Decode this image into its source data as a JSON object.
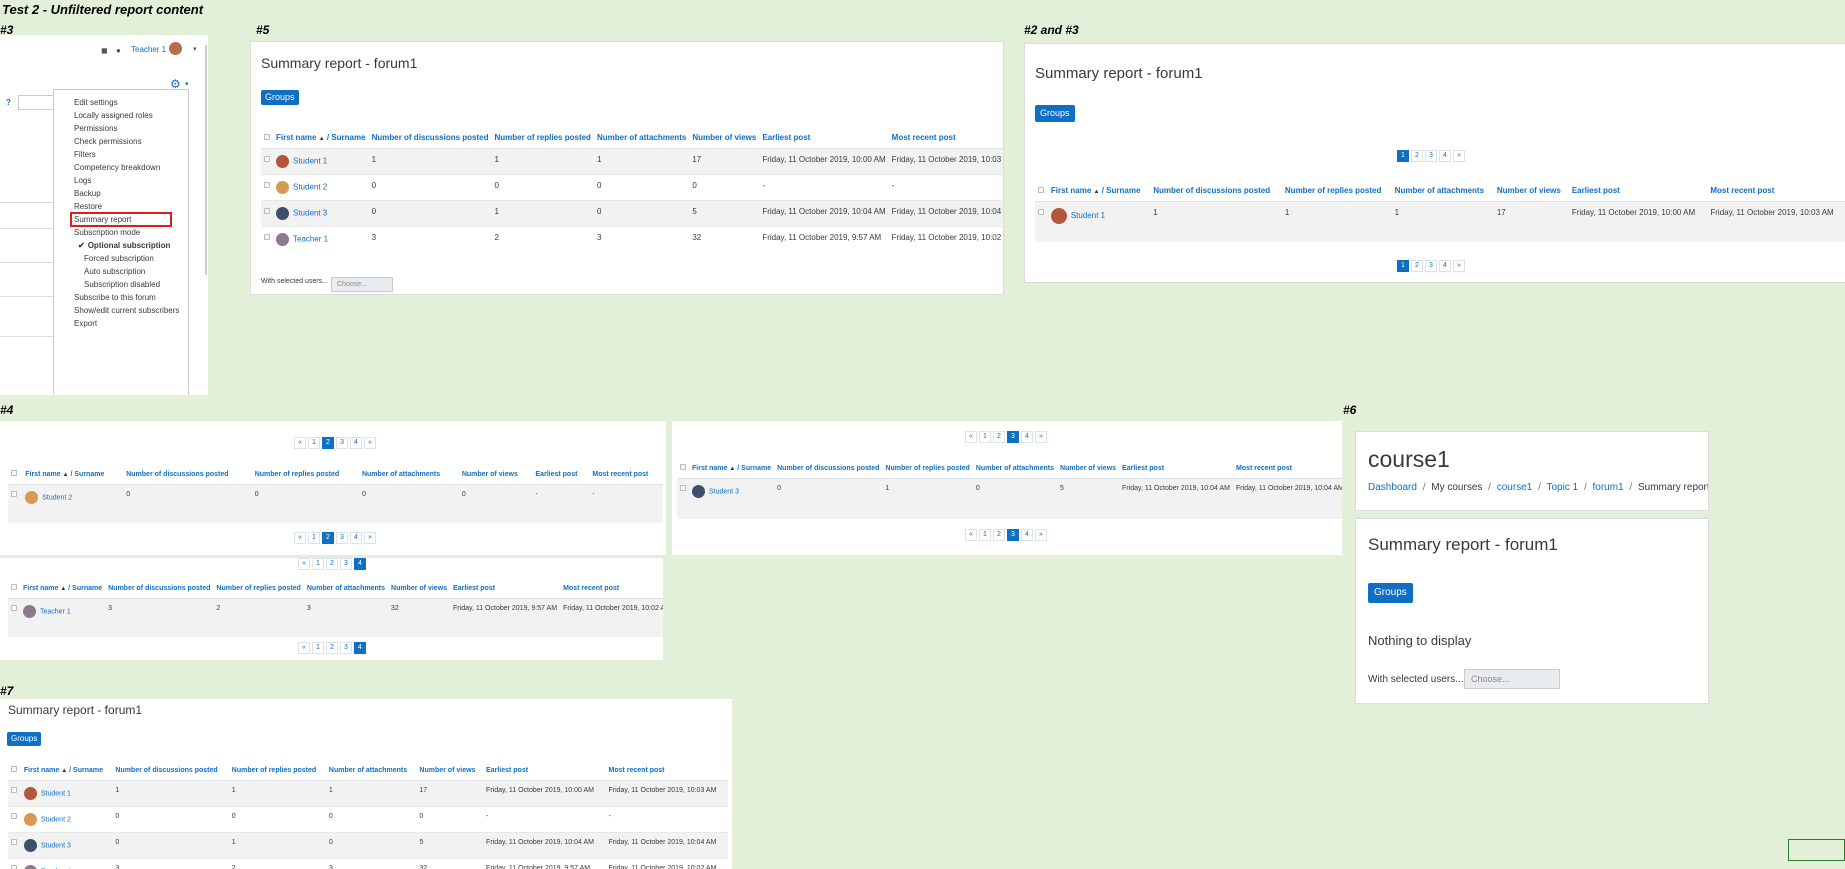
{
  "page_title": "Test 2 - Unfiltered report content",
  "colors": {
    "background": "#e2efd9",
    "accent": "#0f6fc5",
    "highlight_box": "#e01b1b"
  },
  "labels": {
    "p3": "#3",
    "p5": "#5",
    "p23": "#2 and #3",
    "p4": "#4",
    "p6": "#6",
    "p7": "#7"
  },
  "common": {
    "report_title": "Summary report - forum1",
    "groups_btn": "Groups",
    "with_selected": "With selected users...",
    "choose": "Choose...",
    "nothing": "Nothing to display",
    "sort_asc": "▲",
    "prev": "«",
    "next": "»",
    "pages": [
      "1",
      "2",
      "3",
      "4"
    ],
    "headers": {
      "first": "First name",
      "slash_surname": "/ Surname",
      "disc": "Number of discussions posted",
      "reply": "Number of replies posted",
      "attach": "Number of attachments",
      "views": "Number of views",
      "earliest": "Earliest post",
      "recent": "Most recent post"
    }
  },
  "students": {
    "s1": {
      "name": "Student 1",
      "disc": "1",
      "reply": "1",
      "attach": "1",
      "views": "17",
      "earliest": "Friday, 11 October 2019, 10:00 AM",
      "recent": "Friday, 11 October 2019, 10:03 AM"
    },
    "s2": {
      "name": "Student 2",
      "disc": "0",
      "reply": "0",
      "attach": "0",
      "views": "0",
      "earliest": "-",
      "recent": "-"
    },
    "s3": {
      "name": "Student 3",
      "disc": "0",
      "reply": "1",
      "attach": "0",
      "views": "5",
      "earliest": "Friday, 11 October 2019, 10:04 AM",
      "recent": "Friday, 11 October 2019, 10:04 AM"
    },
    "t1": {
      "name": "Teacher 1",
      "disc": "3",
      "reply": "2",
      "attach": "3",
      "views": "32",
      "earliest": "Friday, 11 October 2019, 9:57 AM",
      "recent": "Friday, 11 October 2019, 10:02 AM"
    }
  },
  "p3": {
    "user": "Teacher 1",
    "help": "?",
    "menu": [
      "Edit settings",
      "Locally assigned roles",
      "Permissions",
      "Check permissions",
      "Filters",
      "Competency breakdown",
      "Logs",
      "Backup",
      "Restore",
      "Summary report",
      "Subscription mode"
    ],
    "sub": [
      "Optional subscription",
      "Forced subscription",
      "Auto subscription",
      "Subscription disabled"
    ],
    "menu2": [
      "Subscribe to this forum",
      "Show/edit current subscribers",
      "Export"
    ],
    "check": "✔"
  },
  "p6": {
    "course": "course1",
    "bc": [
      "Dashboard",
      "My courses",
      "course1",
      "Topic 1",
      "forum1",
      "Summary report"
    ],
    "sep": "/"
  }
}
